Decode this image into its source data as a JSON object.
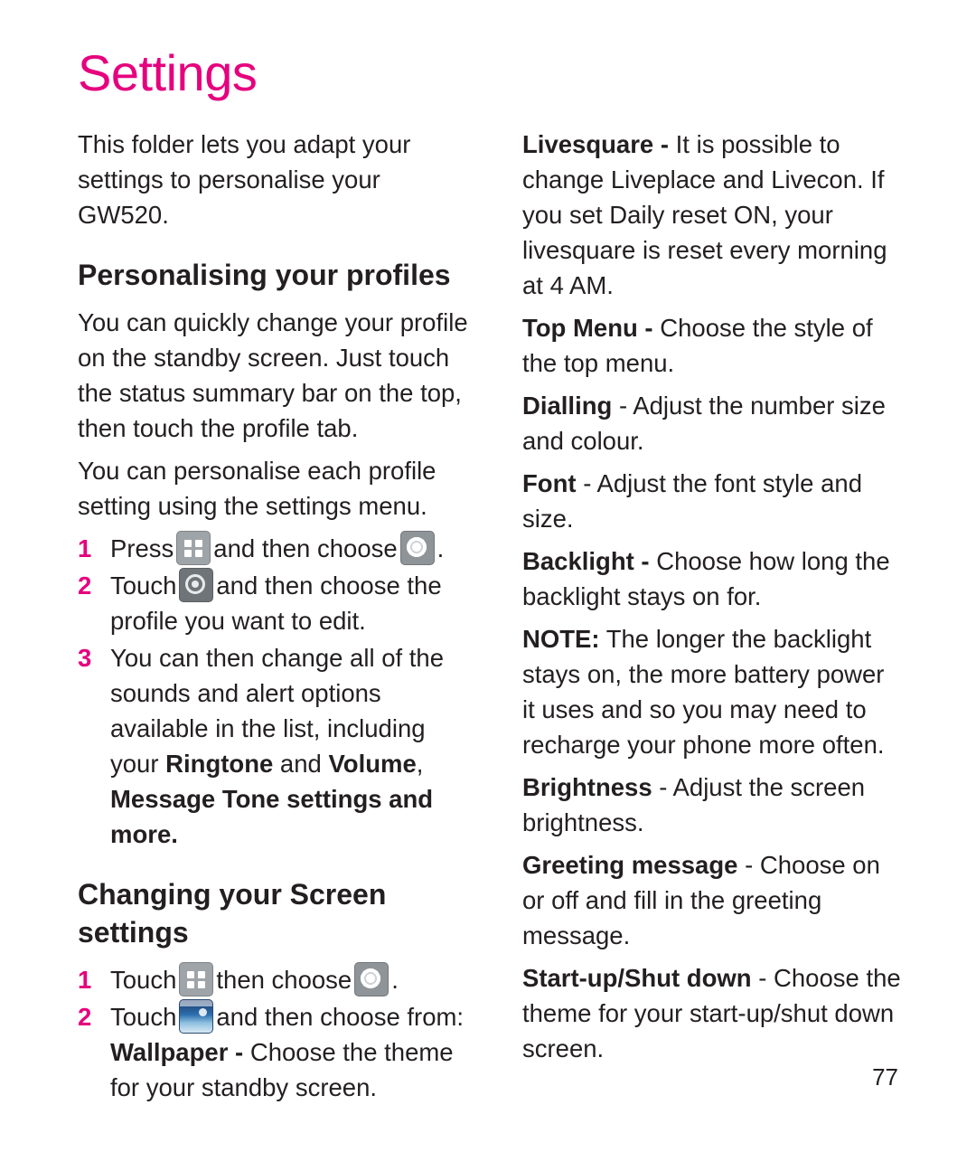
{
  "page": {
    "title": "Settings",
    "number": "77"
  },
  "left_column": {
    "intro": "This folder lets you adapt your settings to personalise your GW520.",
    "heading1": "Personalising your profiles",
    "para1": "You can quickly change your profile on the standby screen. Just touch the status summary bar on the top, then touch the profile tab.",
    "para2": "You can personalise each profile setting using the settings menu.",
    "steps1": [
      {
        "num": "1",
        "before": "Press",
        "icon1": "grid-icon",
        "middle": "and then choose",
        "icon2": "gear-icon",
        "after": "."
      },
      {
        "num": "2",
        "before": "Touch",
        "icon1": "profiles-icon",
        "middle": "and then choose the",
        "after": "profile you want to edit."
      },
      {
        "num": "3",
        "text": "You can then change all of the sounds and alert options available in the list, including your",
        "bold_run": "Ringtone and Volume, Message Tone settings and more."
      }
    ],
    "step3_bold1": "Ringtone",
    "step3_mid1": " and ",
    "step3_bold2": "Volume",
    "step3_mid2": ", ",
    "step3_bold3": "Message Tone",
    "step3_tail": " settings and more.",
    "heading2": "Changing your Screen settings",
    "steps2": [
      {
        "num": "1",
        "before": "Touch",
        "icon1": "grid-icon",
        "middle": "then choose",
        "icon2": "gear-icon",
        "after": "."
      },
      {
        "num": "2",
        "before": "Touch",
        "icon1": "screen-icon",
        "middle": "and then choose from:"
      }
    ],
    "wallpaper_bold": "Wallpaper -",
    "wallpaper_text": " Choose the theme for your standby screen."
  },
  "right_column": {
    "entries": [
      {
        "term": "Livesquare",
        "sep": " -",
        "text": "  It is possible to change Liveplace and Livecon. If you set Daily reset ON,  your livesquare is reset every morning at 4 AM."
      },
      {
        "term": "Top Menu",
        "sep": " -",
        "text": " Choose the style of the top menu."
      },
      {
        "term": "Dialling",
        "sep": "",
        "text": " - Adjust the number size and colour."
      },
      {
        "term": "Font",
        "sep": "",
        "text": " - Adjust the font style and size."
      },
      {
        "term": "Backlight",
        "sep": " -",
        "text": " Choose how long the backlight stays on for."
      },
      {
        "term": "NOTE:",
        "sep": "",
        "text": " The longer the backlight stays on, the more battery power it uses and so you may need to recharge your phone more often."
      },
      {
        "term": "Brightness",
        "sep": "",
        "text": " - Adjust the screen brightness."
      },
      {
        "term": "Greeting message",
        "sep": "",
        "text": " - Choose on or off and fill in the greeting message."
      },
      {
        "term": "Start-up/Shut down",
        "sep": "",
        "text": " - Choose the theme for your start-up/shut down screen."
      }
    ]
  },
  "colors": {
    "accent": "#e6007e",
    "text": "#231f20"
  }
}
